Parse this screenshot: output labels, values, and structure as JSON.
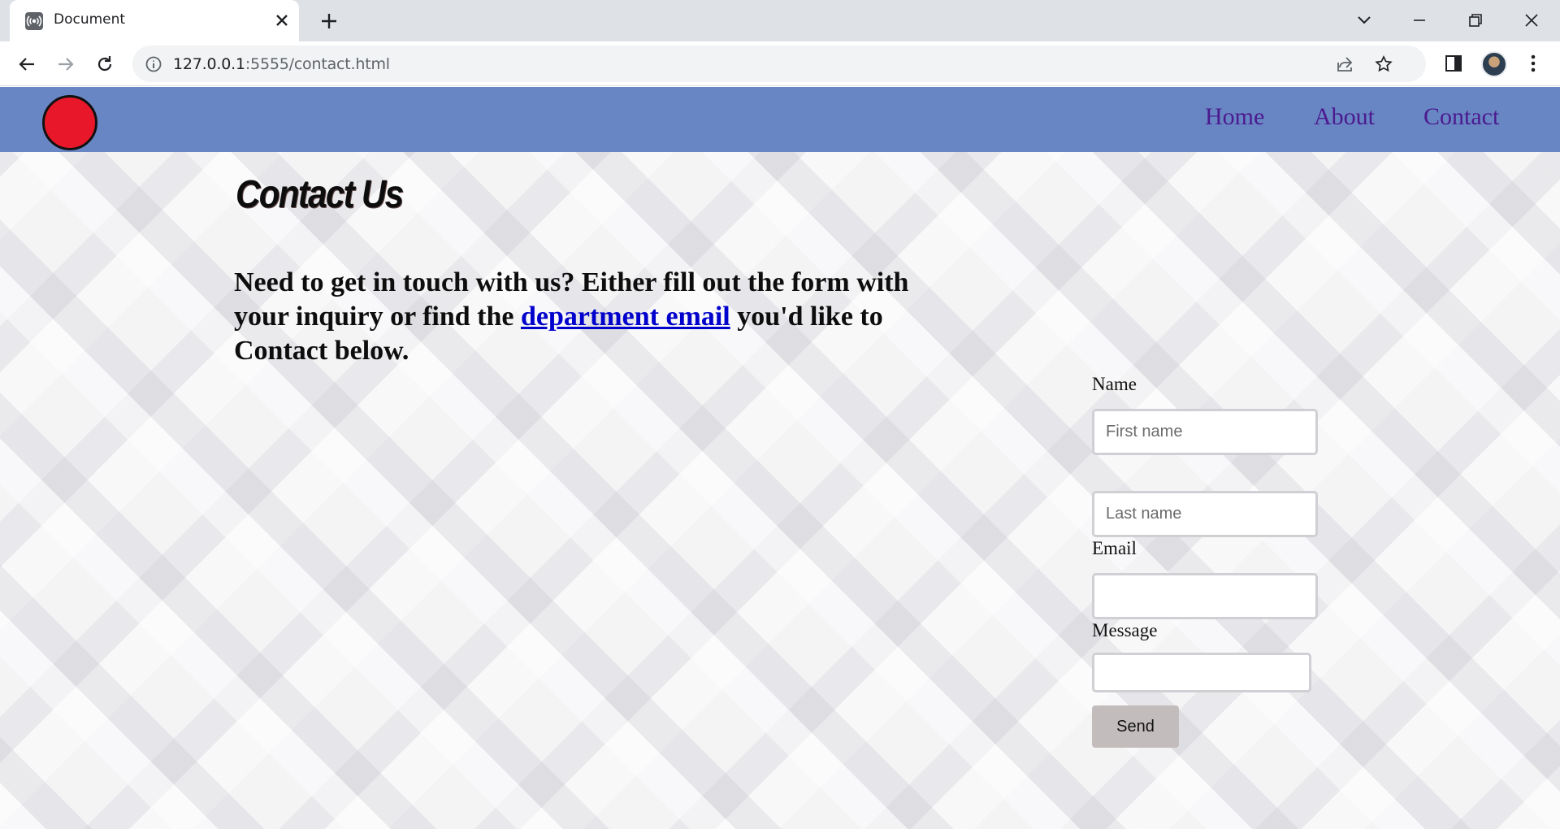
{
  "browser": {
    "tab_title": "Document",
    "url_host": "127.0.0.1",
    "url_rest": ":5555/contact.html"
  },
  "site": {
    "nav": [
      {
        "label": "Home"
      },
      {
        "label": "About"
      },
      {
        "label": "Contact"
      }
    ],
    "title": "Contact Us",
    "intro_before": "Need to get in touch with us? Either fill out the form with your inquiry or find the ",
    "intro_link": "department email",
    "intro_after": "  you'd like to Contact below.",
    "form": {
      "name_label": "Name",
      "first_name_placeholder": "First name",
      "last_name_placeholder": "Last name",
      "email_label": "Email",
      "message_label": "Message",
      "send_label": "Send"
    }
  },
  "colors": {
    "header_bg": "#6886c4",
    "nav_link": "#4b1a8f",
    "logo": "#e8182a",
    "send_button": "#c3bcbc"
  },
  "icons": [
    "broadcast-favicon-icon",
    "close-icon",
    "plus-icon",
    "chevron-down-icon",
    "minimize-icon",
    "restore-icon",
    "window-close-icon",
    "back-arrow-icon",
    "forward-arrow-icon",
    "reload-icon",
    "info-icon",
    "share-icon",
    "star-icon",
    "side-panel-icon",
    "kebab-menu-icon"
  ]
}
